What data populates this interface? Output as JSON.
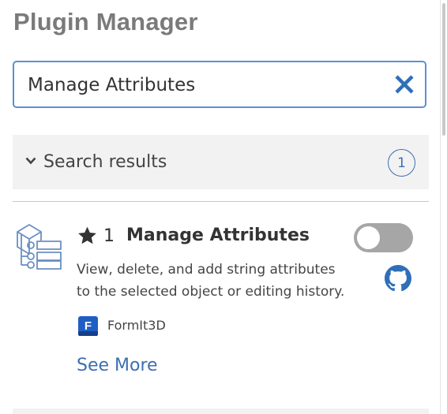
{
  "header": {
    "title": "Plugin Manager"
  },
  "search": {
    "value": "Manage Attributes",
    "clear_icon": "close-icon"
  },
  "results": {
    "label": "Search results",
    "count": "1",
    "expanded": true
  },
  "plugin": {
    "icon": "attribute-tree-icon",
    "star_icon": "star-icon",
    "stars": "1",
    "name": "Manage Attributes",
    "description": "View, delete, and add string attributes to the selected object or editing history.",
    "enabled": false,
    "source_icon": "github-icon",
    "product_icon": "formit-icon",
    "product_letter": "F",
    "product": "FormIt3D",
    "see_more": "See More"
  },
  "colors": {
    "accent": "#3b6fb0",
    "title": "#7a7a7a",
    "search_border": "#5b8fd3",
    "header_bg": "#f2f2f2",
    "toggle_off": "#a6a6a6",
    "product_blue": "#1f5ec4"
  }
}
